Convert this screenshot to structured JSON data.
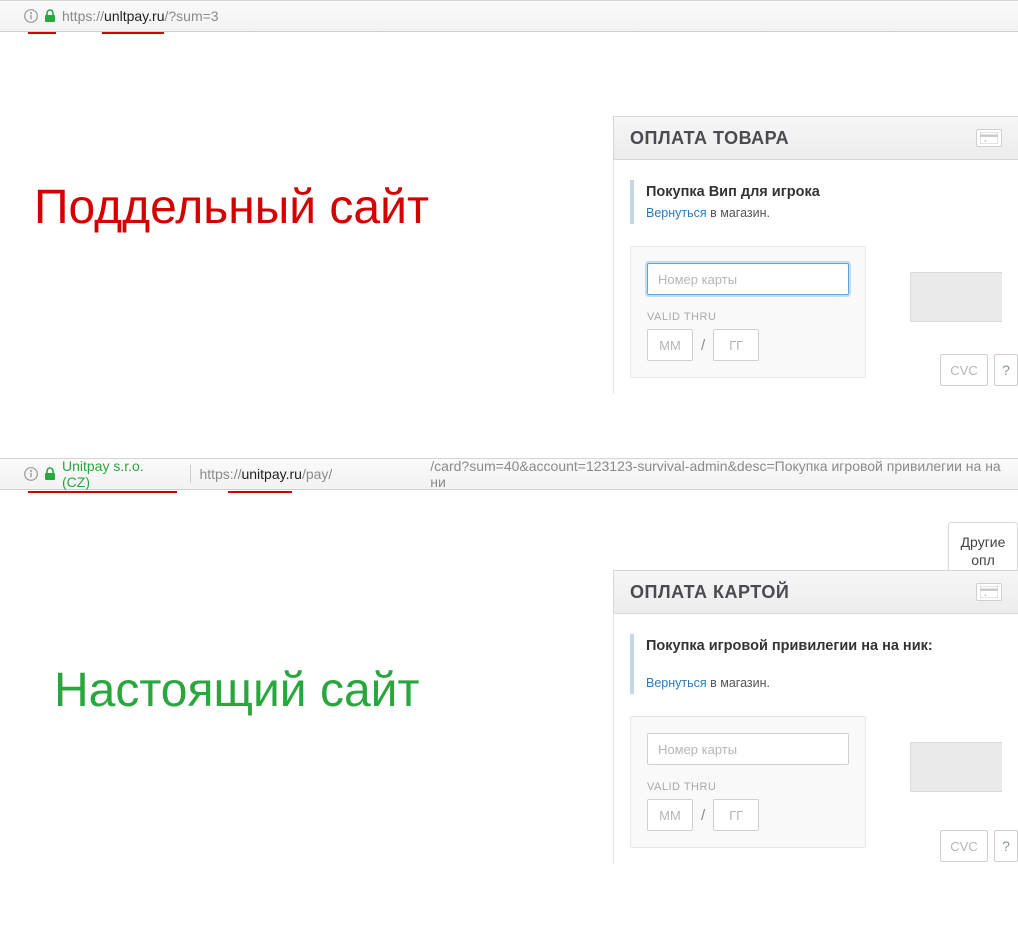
{
  "fake": {
    "url_prefix": "https://",
    "url_bold": "unltpay.ru",
    "url_path": "/?sum=3",
    "label": "Поддельный сайт",
    "panel_title": "ОПЛАТА ТОВАРА",
    "purchase_desc": "Покупка Вип для игрока",
    "return_link": "Вернуться",
    "return_suffix": " в магазин.",
    "card_placeholder": "Номер карты",
    "valid_label": "VALID THRU",
    "mm_placeholder": "ММ",
    "yy_placeholder": "ГГ",
    "cvc_placeholder": "CVC",
    "cvc_help": "?"
  },
  "real": {
    "cert": "Unitpay s.r.o. (CZ)",
    "url_prefix": "https://",
    "url_bold": "unitpay.ru",
    "url_path_visible": "/pay/",
    "url_query": "/card?sum=40&account=123123-survival-admin&desc=Покупка игровой привилегии на на ни",
    "label": "Настоящий сайт",
    "panel_title": "ОПЛАТА КАРТОЙ",
    "purchase_desc": "Покупка игровой привилегии на на ник:",
    "return_link": "Вернуться",
    "return_suffix": " в магазин.",
    "card_placeholder": "Номер карты",
    "valid_label": "VALID THRU",
    "mm_placeholder": "ММ",
    "yy_placeholder": "ГГ",
    "cvc_placeholder": "CVC",
    "cvc_help": "?",
    "popup_line1": "Другие",
    "popup_line2": "опл"
  }
}
